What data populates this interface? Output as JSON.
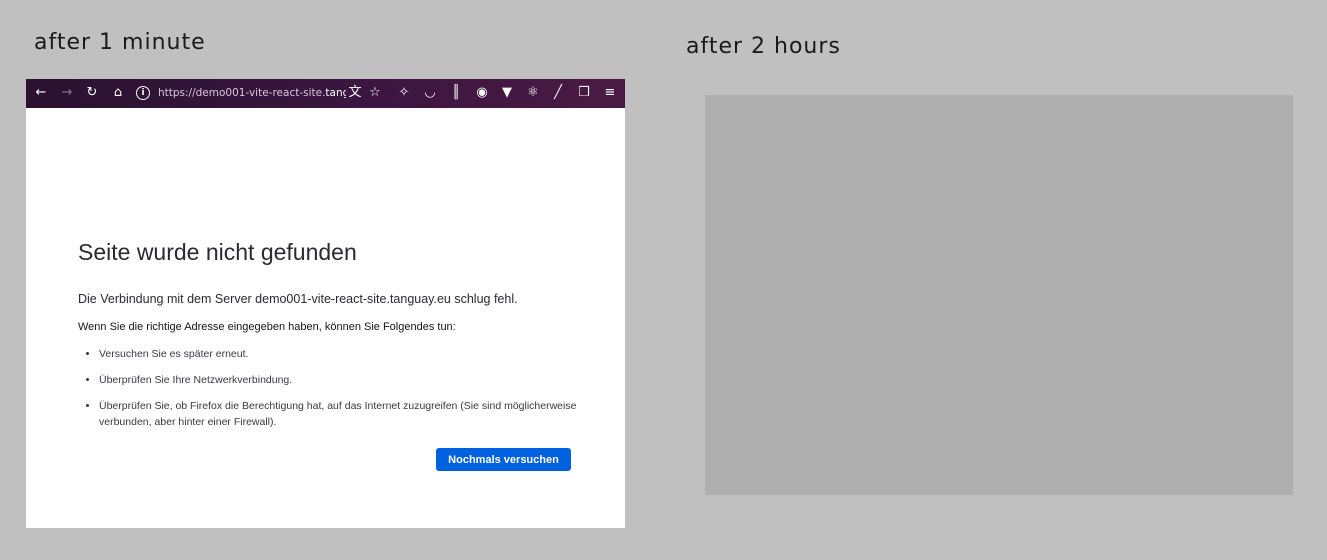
{
  "captions": {
    "left": "after 1 minute",
    "right": "after 2 hours"
  },
  "browser": {
    "toolbar": {
      "back_icon": "arrow-left-icon",
      "forward_icon": "arrow-right-icon",
      "reload_icon": "reload-icon",
      "home_icon": "home-icon",
      "site_info_icon": "info-icon",
      "url_prefix": "https://demo001-vite-react-site.",
      "url_domain": "tanguay.e",
      "icons": [
        "translate-icon",
        "bookmark-star-icon",
        "extension-puzzle-icon",
        "pocket-icon",
        "library-icon",
        "account-icon",
        "vue-devtools-icon",
        "react-devtools-icon",
        "color-picker-icon",
        "extensions-icon",
        "menu-icon"
      ]
    },
    "error_page": {
      "title": "Seite wurde nicht gefunden",
      "description": "Die Verbindung mit dem Server demo001-vite-react-site.tanguay.eu schlug fehl.",
      "subheading": "Wenn Sie die richtige Adresse eingegeben haben, können Sie Folgendes tun:",
      "suggestions": [
        "Versuchen Sie es später erneut.",
        "Überprüfen Sie Ihre Netzwerkverbindung.",
        "Überprüfen Sie, ob Firefox die Berechtigung hat, auf das Internet zuzugreifen (Sie sind möglicherweise verbunden, aber hinter einer Firewall)."
      ],
      "retry_label": "Nochmals versuchen"
    }
  },
  "colors": {
    "background": "#c0c0c0",
    "placeholder": "#afafaf",
    "toolbar": "#3a1640",
    "button": "#0061e0"
  }
}
